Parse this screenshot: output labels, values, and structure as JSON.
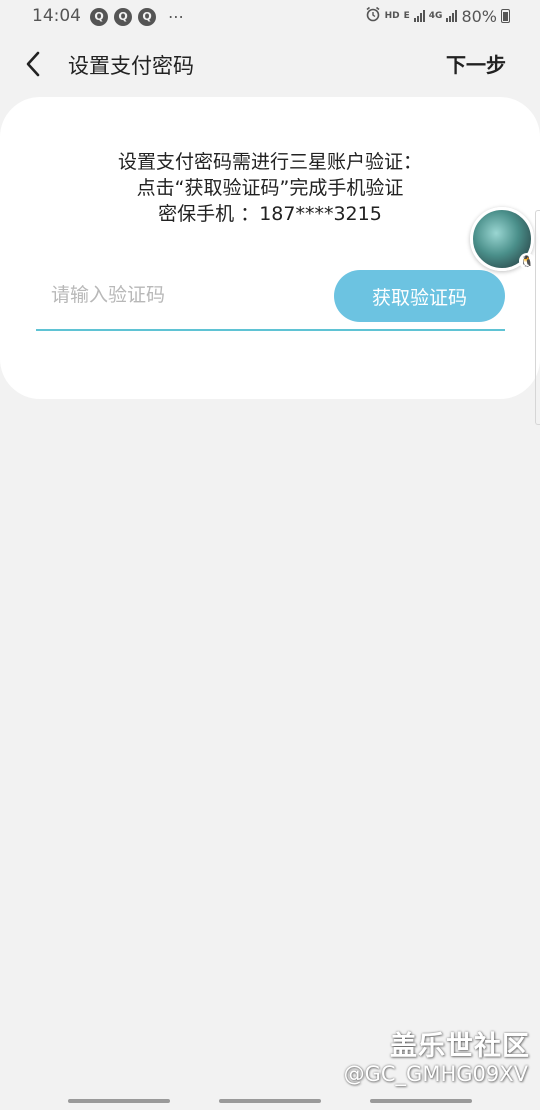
{
  "status_bar": {
    "time": "14:04",
    "notification_icons": [
      "Q",
      "Q",
      "Q"
    ],
    "more": "⋯",
    "hd": "HD",
    "network_e": "E",
    "network_4g": "4G",
    "battery": "80%"
  },
  "header": {
    "title": "设置支付密码",
    "next_label": "下一步"
  },
  "card": {
    "line1": "设置支付密码需进行三星账户验证：",
    "line2": "点击“获取验证码”完成手机验证",
    "line3": "密保手机 ：187****3215",
    "input_placeholder": "请输入验证码",
    "input_value": "",
    "get_code_label": "获取验证码"
  },
  "watermark": {
    "site": "盖乐世社区",
    "user": "@GC_GMHG09XV"
  },
  "colors": {
    "accent": "#6cc3e1",
    "underline": "#5fc3d4",
    "background": "#f2f2f2"
  }
}
